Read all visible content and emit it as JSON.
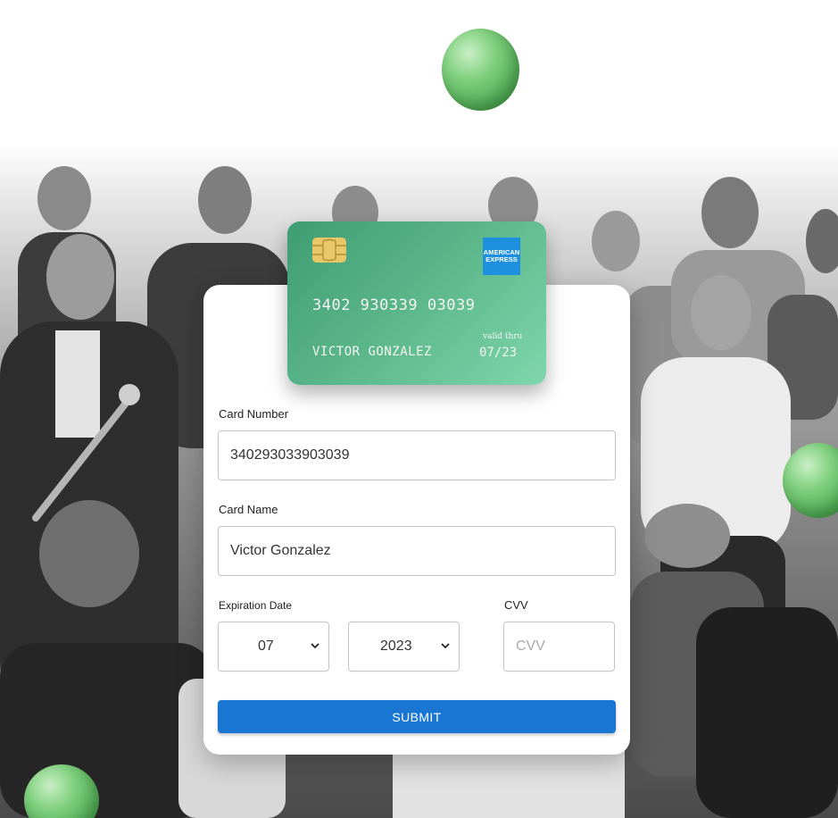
{
  "card_preview": {
    "number": "3402 930339 03039",
    "holder": "VICTOR GONZALEZ",
    "valid_thru_label": "valid thru",
    "expiry": "07/23",
    "brand_line1": "AMERICAN",
    "brand_line2": "EXPRESS"
  },
  "form": {
    "card_number_label": "Card Number",
    "card_number_value": "340293033903039",
    "card_name_label": "Card Name",
    "card_name_value": "Victor Gonzalez",
    "expiration_label": "Expiration Date",
    "month_value": "07",
    "year_value": "2023",
    "cvv_label": "CVV",
    "cvv_placeholder": "CVV",
    "submit_label": "SUBMIT"
  },
  "icons": {
    "chip": "chip-icon",
    "brand": "amex-logo",
    "month_chevron": "chevron-down-icon",
    "year_chevron": "chevron-down-icon"
  },
  "colors": {
    "card_gradient_start": "#3f9c72",
    "card_gradient_end": "#7fd6ac",
    "submit_button": "#1976d2",
    "amex_blue": "#1f8fe0",
    "balloon_green": "#5cbf5e"
  }
}
